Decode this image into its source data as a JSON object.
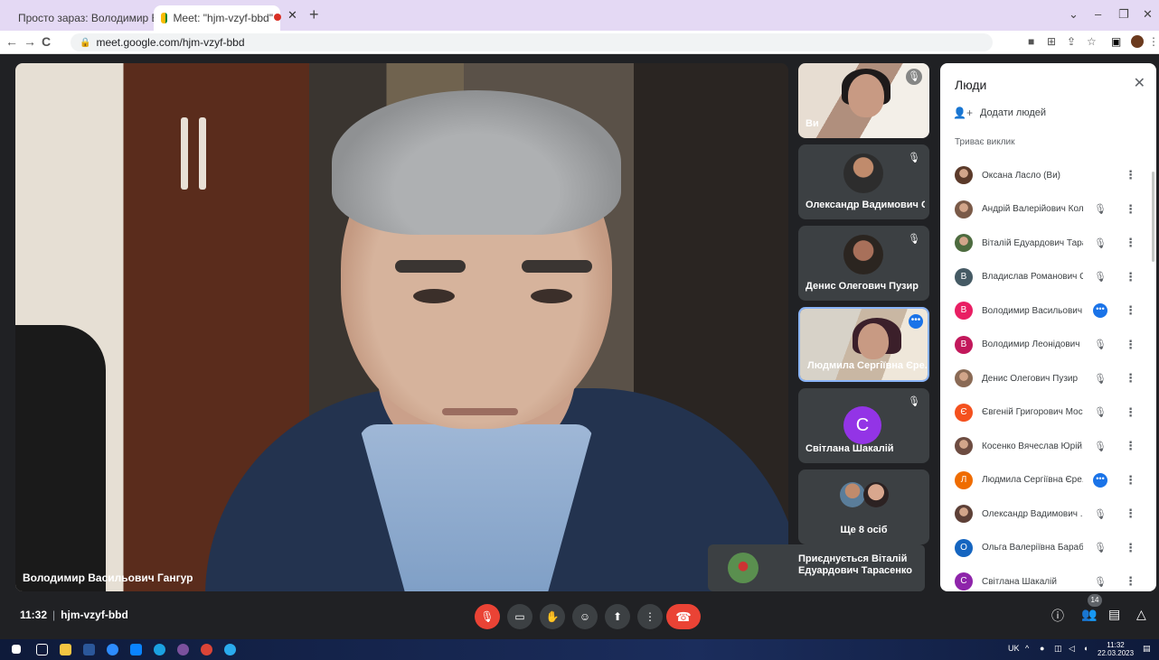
{
  "browser": {
    "tabs": [
      {
        "title": "Просто зараз: Володимир Вася",
        "icon": "gmail-icon",
        "active": false
      },
      {
        "title": "Meet: \"hjm-vzyf-bbd\"",
        "icon": "meet-icon",
        "active": true
      }
    ],
    "url": "meet.google.com/hjm-vzyf-bbd"
  },
  "main_speaker": {
    "name": "Володимир Васильович Гангур"
  },
  "tiles": [
    {
      "name": "Ви",
      "type": "photo",
      "muted": true
    },
    {
      "name": "Олександр Вадимович С...",
      "type": "avatar-photo",
      "muted": true
    },
    {
      "name": "Денис Олегович Пузир",
      "type": "avatar-photo",
      "muted": true
    },
    {
      "name": "Людмила Сергіївна Єре...",
      "type": "video",
      "more": true
    },
    {
      "name": "Світлана Шакалій",
      "type": "letter",
      "letter": "С",
      "muted": true
    },
    {
      "name": "Ще 8 осіб",
      "type": "group"
    }
  ],
  "toast": {
    "text": "Приєднується Віталій Едуардович Тарасенко"
  },
  "people_panel": {
    "title": "Люди",
    "add_people": "Додати людей",
    "section": "Триває виклик",
    "participants": [
      {
        "name": "Оксана Ласло (Ви)",
        "avatar": "photo",
        "color": "#5b3a2a",
        "letter": "",
        "status": "none"
      },
      {
        "name": "Андрій Валерійович Кол...",
        "avatar": "photo",
        "color": "#7a5a48",
        "letter": "",
        "status": "muted"
      },
      {
        "name": "Віталій Едуардович Тара...",
        "avatar": "photo",
        "color": "#4d6b3f",
        "letter": "",
        "status": "muted"
      },
      {
        "name": "Владислав Романович С...",
        "avatar": "letter",
        "color": "#455a64",
        "letter": "В",
        "status": "muted"
      },
      {
        "name": "Володимир Васильович ...",
        "avatar": "letter",
        "color": "#e91e63",
        "letter": "В",
        "status": "active"
      },
      {
        "name": "Володимир Леонідович ...",
        "avatar": "letter",
        "color": "#c2185b",
        "letter": "В",
        "status": "muted"
      },
      {
        "name": "Денис Олегович Пузир",
        "avatar": "photo",
        "color": "#8a6a55",
        "letter": "",
        "status": "muted"
      },
      {
        "name": "Євгеній Григорович Мос...",
        "avatar": "letter",
        "color": "#f4511e",
        "letter": "Є",
        "status": "muted"
      },
      {
        "name": "Косенко Вячеслав Юрій...",
        "avatar": "photo",
        "color": "#6d4c41",
        "letter": "",
        "status": "muted"
      },
      {
        "name": "Людмила Сергіївна Єре...",
        "avatar": "letter",
        "color": "#ef6c00",
        "letter": "Л",
        "status": "active"
      },
      {
        "name": "Олександр Вадимович ...",
        "avatar": "photo",
        "color": "#5d4037",
        "letter": "",
        "status": "muted"
      },
      {
        "name": "Ольга Валеріївна Бараб...",
        "avatar": "letter",
        "color": "#1565c0",
        "letter": "О",
        "status": "muted"
      },
      {
        "name": "Світлана Шакалій",
        "avatar": "letter",
        "color": "#8e24aa",
        "letter": "С",
        "status": "muted"
      }
    ]
  },
  "toolbar": {
    "time": "11:32",
    "separator": "|",
    "meeting_code": "hjm-vzyf-bbd",
    "people_count": "14"
  },
  "taskbar": {
    "lang": "UK",
    "clock_time": "11:32",
    "clock_date": "22.03.2023"
  }
}
